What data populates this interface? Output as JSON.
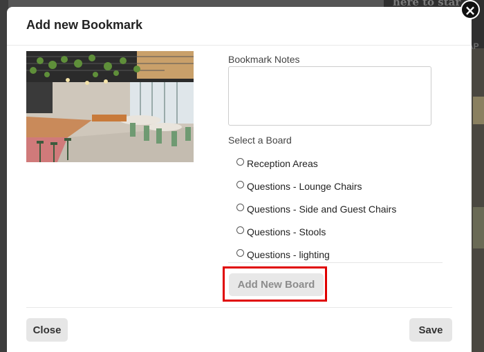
{
  "background": {
    "text": "here to star",
    "text2": "AP"
  },
  "modal": {
    "title": "Add new Bookmark",
    "close_icon": "×"
  },
  "image": {
    "icon": "office-cafe-photo"
  },
  "notes": {
    "label": "Bookmark Notes",
    "value": ""
  },
  "boards": {
    "label": "Select a Board",
    "items": [
      {
        "label": "Reception Areas",
        "checked": false
      },
      {
        "label": "Questions - Lounge Chairs",
        "checked": false
      },
      {
        "label": "Questions - Side and Guest Chairs",
        "checked": false
      },
      {
        "label": "Questions - Stools",
        "checked": false
      },
      {
        "label": "Questions - lighting",
        "checked": false
      }
    ]
  },
  "buttons": {
    "add_new_board": "Add New Board",
    "close": "Close",
    "save": "Save"
  },
  "colors": {
    "highlight": "#e00000",
    "button_bg": "#e6e6e6"
  }
}
